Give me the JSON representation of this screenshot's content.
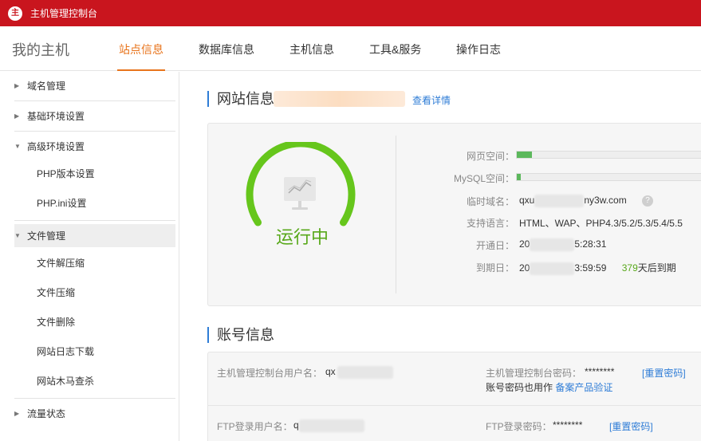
{
  "header": {
    "logo_text": "主",
    "title": "主机管理控制台"
  },
  "nav": {
    "home": "我的主机",
    "tabs": [
      {
        "label": "站点信息",
        "active": true
      },
      {
        "label": "数据库信息",
        "active": false
      },
      {
        "label": "主机信息",
        "active": false
      },
      {
        "label": "工具&服务",
        "active": false
      },
      {
        "label": "操作日志",
        "active": false
      }
    ]
  },
  "sidebar": {
    "domain": "域名管理",
    "basic_env": "基础环境设置",
    "advanced_env": "高级环境设置",
    "php_version": "PHP版本设置",
    "php_ini": "PHP.ini设置",
    "file_mgmt": "文件管理",
    "file_unzip": "文件解压缩",
    "file_zip": "文件压缩",
    "file_delete": "文件删除",
    "log_download": "网站日志下载",
    "trojan_scan": "网站木马查杀",
    "traffic": "流量状态"
  },
  "site": {
    "title": "网站信息",
    "detail_link": "查看详情",
    "status": "运行中",
    "web_space_label": "网页空间：",
    "web_space_used": 0.08,
    "mysql_space_label": "MySQL空间：",
    "mysql_space_used": 0.02,
    "temp_domain_label": "临时域名：",
    "temp_domain_prefix": "qxu",
    "temp_domain_suffix": "ny3w.com",
    "help_icon": "?",
    "languages_label": "支持语言：",
    "languages": "HTML、WAP、PHP4.3/5.2/5.3/5.4/5.5",
    "open_date_label": "开通日：",
    "open_date_prefix": "20",
    "open_date_suffix": "5:28:31",
    "expire_date_label": "到期日：",
    "expire_date_prefix": "20",
    "expire_date_suffix": "3:59:59",
    "days_left_number": "379",
    "days_left_text": "天后到期"
  },
  "account": {
    "title": "账号信息",
    "console_user_label": "主机管理控制台用户名：",
    "console_user_value": "qx",
    "console_pwd_label": "主机管理控制台密码：",
    "console_pwd_value": "********",
    "reset_pwd": "[重置密码]",
    "note_prefix": "账号密码也用作",
    "note_link": "备案产品验证",
    "ftp_user_label": "FTP登录用户名：",
    "ftp_user_value": "q",
    "ftp_pwd_label": "FTP登录密码：",
    "ftp_pwd_value": "********",
    "ftp_reset_pwd": "[重置密码]"
  },
  "colors": {
    "brand_red": "#c9151e",
    "accent_orange": "#e8741c",
    "status_green": "#58a81a",
    "link_blue": "#2e7cd6"
  }
}
